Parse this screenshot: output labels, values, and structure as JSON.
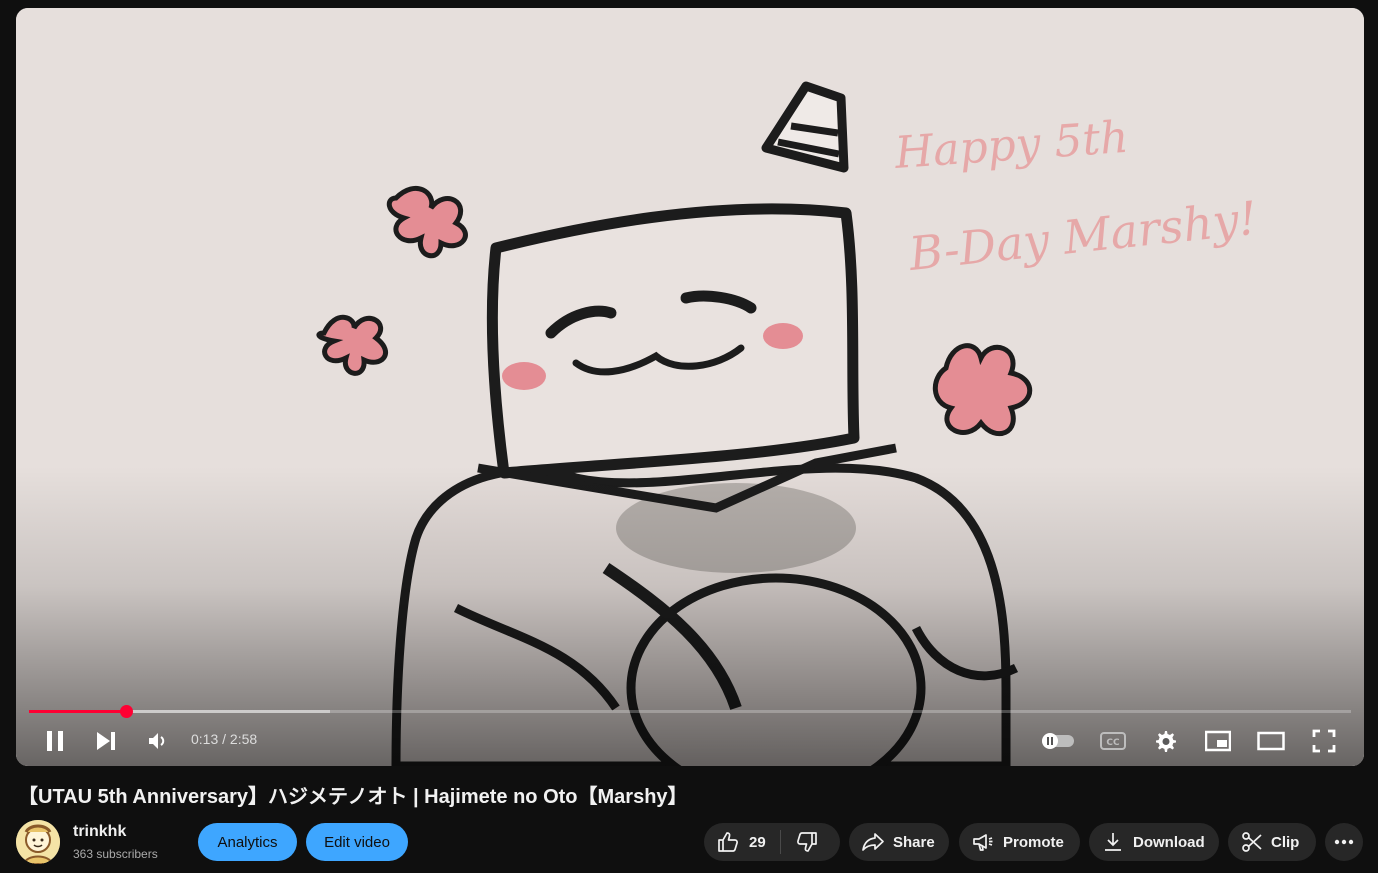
{
  "player": {
    "time_current": "0:13",
    "time_separator": " / ",
    "time_total": "2:58",
    "played_fraction": 0.073,
    "buffered_fraction": 0.228,
    "accent_color": "#f03",
    "artwork_text": "Happy 5th B-Day Marshy!",
    "controls": {
      "pause_icon": "pause-icon",
      "next_icon": "next-icon",
      "volume_icon": "volume-icon",
      "autoplay_icon": "autoplay-toggle-icon",
      "captions_icon": "cc-icon",
      "settings_icon": "gear-icon",
      "miniplayer_icon": "miniplayer-icon",
      "theater_icon": "theater-icon",
      "fullscreen_icon": "fullscreen-icon"
    }
  },
  "video": {
    "title": "【UTAU 5th Anniversary】ハジメテノオト | Hajimete no Oto【Marshy】"
  },
  "channel": {
    "name": "trinkhk",
    "subscribers": "363 subscribers"
  },
  "actions": {
    "analytics_label": "Analytics",
    "edit_label": "Edit video",
    "like_count": "29",
    "share_label": "Share",
    "promote_label": "Promote",
    "download_label": "Download",
    "clip_label": "Clip",
    "accent_blue": "#3ea6ff"
  }
}
